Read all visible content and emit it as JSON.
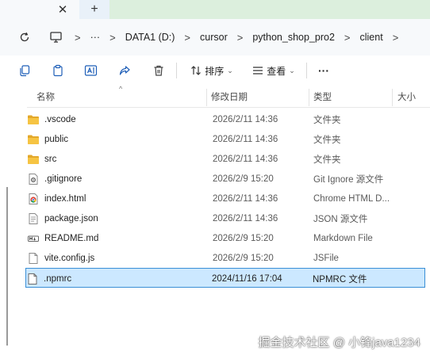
{
  "tabs": {
    "close_glyph": "✕",
    "new_tab_glyph": "+"
  },
  "breadcrumbs": [
    "DATA1 (D:)",
    "cursor",
    "python_shop_pro2",
    "client"
  ],
  "more_crumbs": "···",
  "separator": ">",
  "toolbar": {
    "sort_label": "排序",
    "view_label": "查看",
    "more_label": "···",
    "chevron": "⌄"
  },
  "columns": {
    "name": "名称",
    "date": "修改日期",
    "type": "类型",
    "size": "大小",
    "sort_glyph": "^"
  },
  "files": [
    {
      "name": ".vscode",
      "date": "2026/2/11 14:36",
      "type": "文件夹",
      "icon": "folder-icon"
    },
    {
      "name": "public",
      "date": "2026/2/11 14:36",
      "type": "文件夹",
      "icon": "folder-icon"
    },
    {
      "name": "src",
      "date": "2026/2/11 14:36",
      "type": "文件夹",
      "icon": "folder-icon"
    },
    {
      "name": ".gitignore",
      "date": "2026/2/9 15:20",
      "type": "Git Ignore 源文件",
      "icon": "gitignore-file-icon"
    },
    {
      "name": "index.html",
      "date": "2026/2/11 14:36",
      "type": "Chrome HTML D...",
      "icon": "chrome-html-file-icon"
    },
    {
      "name": "package.json",
      "date": "2026/2/11 14:36",
      "type": "JSON 源文件",
      "icon": "json-file-icon"
    },
    {
      "name": "README.md",
      "date": "2026/2/9 15:20",
      "type": "Markdown File",
      "icon": "markdown-file-icon"
    },
    {
      "name": "vite.config.js",
      "date": "2026/2/9 15:20",
      "type": "JSFile",
      "icon": "js-file-icon"
    },
    {
      "name": ".npmrc",
      "date": "2024/11/16 17:04",
      "type": "NPMRC 文件",
      "icon": "npmrc-file-icon",
      "selected": true
    }
  ],
  "watermark": "掘金技术社区 @ 小锋java1234",
  "colors": {
    "folder": "#f6c443",
    "folder_dark": "#e3a82b",
    "selection_bg": "#cce8ff",
    "selection_border": "#3a8fd6",
    "tab_green": "#dcefdd"
  }
}
